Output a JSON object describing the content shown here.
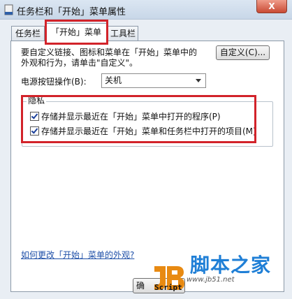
{
  "window": {
    "title": "任务栏和「开始」菜单属性",
    "close_label": "X"
  },
  "tabs": [
    {
      "label": "任务栏",
      "active": false
    },
    {
      "label": "「开始」菜单",
      "active": true
    },
    {
      "label": "工具栏",
      "active": false
    }
  ],
  "start_menu": {
    "description_line1": "要自定义链接、图标和菜单在「开始」菜单中的",
    "description_line2": "外观和行为，请单击\"自定义\"。",
    "customize_button": "自定义(C)...",
    "power_label": "电源按钮操作(B):",
    "power_value": "关机"
  },
  "privacy": {
    "title": "隐私",
    "items": [
      {
        "label": "存储并显示最近在「开始」菜单中打开的程序(P)",
        "checked": true
      },
      {
        "label": "存储并显示最近在「开始」菜单和任务栏中打开的项目(M)",
        "checked": true
      }
    ]
  },
  "help_link": "如何更改「开始」菜单的外观?",
  "ok_button": "确",
  "watermark": {
    "logo_script": "Script",
    "brand_cn": "脚本之家",
    "url": "www.jb51.net"
  },
  "colors": {
    "highlight": "#d2232a",
    "link": "#1e4fa8",
    "brand": "#1f7fd6"
  }
}
